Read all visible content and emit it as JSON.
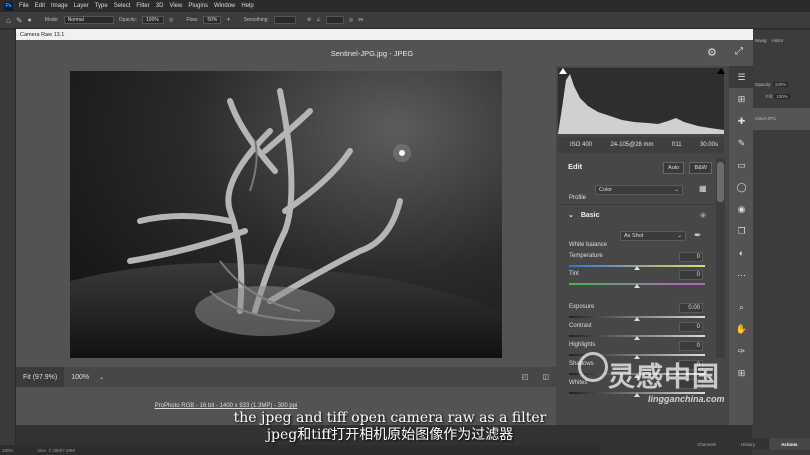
{
  "menubar": {
    "logo": "Ps",
    "items": [
      "File",
      "Edit",
      "Image",
      "Layer",
      "Type",
      "Select",
      "Filter",
      "3D",
      "View",
      "Plugins",
      "Window",
      "Help"
    ]
  },
  "options_bar": {
    "mode_label": "Mode:",
    "mode_value": "Normal",
    "opacity_label": "Opacity:",
    "opacity_value": "100%",
    "flow_label": "Flow:",
    "flow_value": "50%",
    "smoothing_label": "Smoothing:"
  },
  "dialog": {
    "title": "Camera Raw 13.1",
    "doc_title": "Sentinel-JPG.jpg  -  JPEG"
  },
  "zoom": {
    "fit_label": "Fit (97.9%)",
    "pct_label": "100%"
  },
  "info_line": "ProPhoto RGB - 16 bit - 1400 x 933 (1.3MP) - 300 ppi",
  "camera": {
    "iso": "ISO 400",
    "lens": "24-105@28 mm",
    "aperture": "f/11",
    "shutter": "30.00s"
  },
  "edit": {
    "title": "Edit",
    "auto_label": "Auto",
    "bw_label": "B&W",
    "profile_label": "Profile",
    "profile_value": "Color",
    "basic_label": "Basic",
    "wb_label": "White balance",
    "wb_value": "As Shot"
  },
  "sliders": [
    {
      "label": "Temperature",
      "value": "0",
      "pct": 0.5,
      "gradient": "linear-gradient(90deg,#3b6fd4,#e0e060)"
    },
    {
      "label": "Tint",
      "value": "0",
      "pct": 0.5,
      "gradient": "linear-gradient(90deg,#3fb950,#c25ad0)"
    },
    {
      "label": "Exposure",
      "value": "0.00",
      "pct": 0.5,
      "gradient": "linear-gradient(90deg,#222,#ddd)"
    },
    {
      "label": "Contrast",
      "value": "0",
      "pct": 0.5,
      "gradient": "linear-gradient(90deg,#222,#ddd)"
    },
    {
      "label": "Highlights",
      "value": "0",
      "pct": 0.5,
      "gradient": "linear-gradient(90deg,#222,#ddd)"
    },
    {
      "label": "Shadows",
      "value": "0",
      "pct": 0.5,
      "gradient": "linear-gradient(90deg,#222,#ddd)"
    },
    {
      "label": "Whites",
      "value": "",
      "pct": 0.5,
      "gradient": "linear-gradient(90deg,#222,#ddd)"
    }
  ],
  "ps_right": {
    "tabs_top": [
      "Navig",
      "Histor"
    ],
    "opacity_label": "Opacity:",
    "opacity_value": "100%",
    "fill_label": "Fill:",
    "fill_value": "100%",
    "layer_name": "ntinel-JPG",
    "bottom_tabs": [
      "Channels",
      "History",
      "Actions"
    ]
  },
  "doc_status": "Doc: 7.49M/7.49M",
  "doc_zoom": "100%",
  "subtitle": {
    "en": "the jpeg and tiff open camera raw as a filter",
    "cn": "jpeg和tiff打开相机原始图像作为过滤器"
  },
  "watermark": {
    "cn": "灵感中国",
    "url": "lingganchina.com"
  },
  "colors": {
    "panel_bg": "#474747",
    "dialog_bg": "#535353",
    "ps_bg": "#323232"
  }
}
